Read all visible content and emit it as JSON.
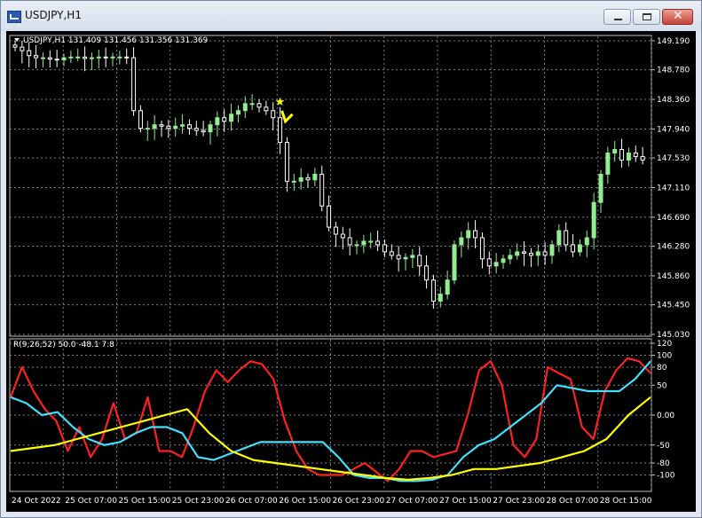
{
  "window": {
    "title": "USDJPY,H1",
    "minimize_label": "—",
    "maximize_label": "□",
    "close_label": "✕"
  },
  "main_chart": {
    "header": "USDJPY,H1  131.409 131.456 131.356 131.369",
    "menu_icon": "triangle-down-icon",
    "colors": {
      "background": "#000000",
      "grid": "#c0c0c0",
      "bull": "#90ee90",
      "bear": "#ffffff",
      "text": "#ffffff",
      "arrow": "#ffff00"
    }
  },
  "indicator": {
    "header": "R(9,26,52) 50.0 -48.1 7.8"
  },
  "chart_data": [
    {
      "type": "candlestick",
      "title": "USDJPY,H1",
      "y_ticks": [
        "149.190",
        "148.780",
        "148.360",
        "147.940",
        "147.530",
        "147.110",
        "146.690",
        "146.280",
        "145.860",
        "145.450",
        "145.030"
      ],
      "ylim": [
        145.03,
        149.19
      ],
      "x_ticks": [
        "24 Oct 2022",
        "25 Oct 07:00",
        "25 Oct 15:00",
        "25 Oct 23:00",
        "26 Oct 07:00",
        "26 Oct 15:00",
        "26 Oct 23:00",
        "27 Oct 07:00",
        "27 Oct 15:00",
        "27 Oct 23:00",
        "28 Oct 07:00",
        "28 Oct 15:00"
      ],
      "grid": true,
      "close_series": [
        149.1,
        149.05,
        148.98,
        148.95,
        148.95,
        148.93,
        148.92,
        148.95,
        148.96,
        148.96,
        148.94,
        148.95,
        148.96,
        148.95,
        148.96,
        148.96,
        148.95,
        148.2,
        147.95,
        147.95,
        148.0,
        147.98,
        147.95,
        147.98,
        148.0,
        147.95,
        147.92,
        147.9,
        148.0,
        148.1,
        148.05,
        148.15,
        148.2,
        148.3,
        148.3,
        148.25,
        148.2,
        148.1,
        147.75,
        147.2,
        147.2,
        147.25,
        147.22,
        147.3,
        146.85,
        146.55,
        146.45,
        146.4,
        146.3,
        146.3,
        146.35,
        146.35,
        146.3,
        146.2,
        146.15,
        146.1,
        146.12,
        146.15,
        146.0,
        145.8,
        145.5,
        145.6,
        145.8,
        146.3,
        146.4,
        146.5,
        146.4,
        146.1,
        146.0,
        146.05,
        146.1,
        146.15,
        146.2,
        146.18,
        146.15,
        146.2,
        146.15,
        146.3,
        146.5,
        146.3,
        146.2,
        146.3,
        146.4,
        146.9,
        147.3,
        147.6,
        147.65,
        147.5,
        147.6,
        147.55,
        147.5
      ],
      "signal_arrow": {
        "index": 38,
        "price": 148.25,
        "direction": "down"
      }
    },
    {
      "type": "line",
      "title": "R(9,26,52)",
      "y_ticks": [
        "120",
        "100",
        "80",
        "50",
        "0.00",
        "-50",
        "-80",
        "-100"
      ],
      "ylim": [
        -120,
        120
      ],
      "series": [
        {
          "color": "#ff2020",
          "values": [
            30,
            80,
            40,
            10,
            -10,
            -60,
            -20,
            -70,
            -40,
            20,
            -40,
            -30,
            30,
            -60,
            -60,
            -70,
            -20,
            40,
            75,
            55,
            75,
            90,
            85,
            60,
            -10,
            -60,
            -90,
            -100,
            -100,
            -100,
            -90,
            -80,
            -95,
            -110,
            -90,
            -60,
            -60,
            -70,
            -65,
            -60,
            0,
            75,
            90,
            50,
            -50,
            -70,
            -40,
            80,
            70,
            60,
            -20,
            -40,
            40,
            75,
            95,
            90,
            70
          ]
        },
        {
          "color": "#40e0ff",
          "values": [
            30,
            20,
            0,
            5,
            -20,
            -40,
            -50,
            -45,
            -30,
            -20,
            -20,
            -30,
            -70,
            -75,
            -65,
            -55,
            -45,
            -45,
            -45,
            -45,
            -45,
            -70,
            -100,
            -105,
            -105,
            -110,
            -110,
            -108,
            -100,
            -70,
            -50,
            -40,
            -20,
            0,
            20,
            50,
            45,
            40,
            40,
            40,
            60,
            90
          ]
        },
        {
          "color": "#ffff00",
          "values": [
            -60,
            -55,
            -50,
            -40,
            -30,
            -20,
            -10,
            0,
            10,
            -30,
            -60,
            -75,
            -80,
            -85,
            -90,
            -95,
            -100,
            -105,
            -108,
            -105,
            -100,
            -90,
            -90,
            -85,
            -80,
            -70,
            -60,
            -40,
            0,
            30
          ]
        }
      ]
    }
  ]
}
